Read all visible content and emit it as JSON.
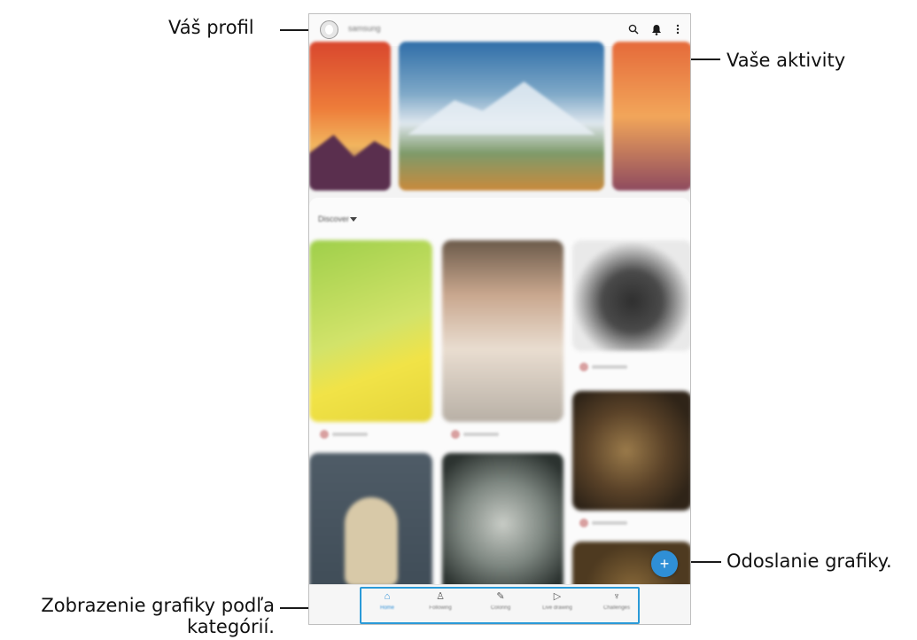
{
  "callouts": {
    "profile": "Váš profil",
    "activities": "Vaše aktivity",
    "upload": "Odoslanie grafiky.",
    "categories_line1": "Zobrazenie grafiky podľa",
    "categories_line2": "kategórií."
  },
  "app": {
    "username": "samsung",
    "icons": {
      "avatar": "avatar",
      "search": "search-icon",
      "bell": "bell-icon",
      "more": "more-vert-icon"
    },
    "discover_label": "Discover",
    "fab_symbol": "+",
    "nav": [
      {
        "label": "Home",
        "icon": "home-icon",
        "glyph": "⌂"
      },
      {
        "label": "Following",
        "icon": "following-icon",
        "glyph": "♙"
      },
      {
        "label": "Coloring",
        "icon": "coloring-icon",
        "glyph": "✎"
      },
      {
        "label": "Live drawing",
        "icon": "live-drawing-icon",
        "glyph": "▷"
      },
      {
        "label": "Challenges",
        "icon": "trophy-icon",
        "glyph": "♆"
      }
    ]
  },
  "colors": {
    "accent": "#2f8fd6",
    "highlight": "#2a9ad8"
  }
}
